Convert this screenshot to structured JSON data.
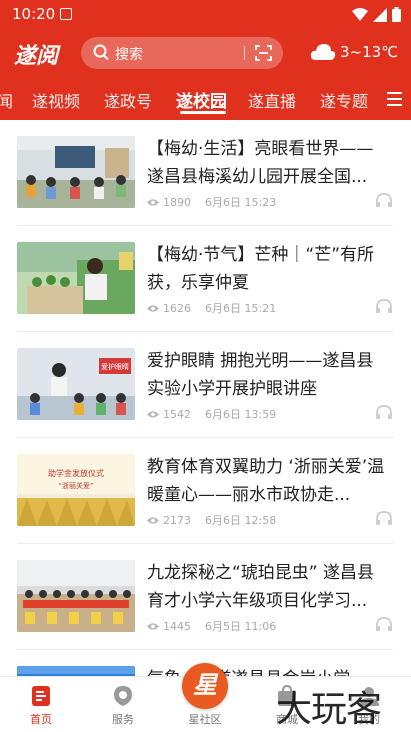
{
  "status": {
    "time": "10:20"
  },
  "header": {
    "logo": "遂阅",
    "search_placeholder": "搜索",
    "weather": "3~13℃"
  },
  "tabs": [
    {
      "label": "闻"
    },
    {
      "label": "遂视频"
    },
    {
      "label": "遂政号"
    },
    {
      "label": "遂校园",
      "active": true
    },
    {
      "label": "遂直播"
    },
    {
      "label": "遂专题"
    }
  ],
  "feed": [
    {
      "title": "【梅幼·生活】亮眼看世界——遂昌县梅溪幼儿园开展全国...",
      "views": "1890",
      "time": "6月6日 15:23"
    },
    {
      "title": "【梅幼·节气】芒种｜“芒”有所获，乐享仲夏",
      "views": "1626",
      "time": "6月6日 15:21"
    },
    {
      "title": "爱护眼睛 拥抱光明——遂昌县实验小学开展护眼讲座",
      "views": "1542",
      "time": "6月6日 13:59"
    },
    {
      "title": "教育体育双翼助力 ‘浙丽关爱’温暖童心——丽水市政协走...",
      "views": "2173",
      "time": "6月6日 12:58"
    },
    {
      "title": "九龙探秘之“琥珀昆虫” 遂昌县育才小学六年级项目化学习...",
      "views": "1445",
      "time": "6月5日 11:06"
    },
    {
      "title": "气象...全道遂昌县金岸小学",
      "views": "",
      "time": ""
    }
  ],
  "thumb_texts": {
    "t3_banner": "爱护眼睛",
    "t4_line1": "助学金发放仪式",
    "t4_line2": "“浙丽关爱”"
  },
  "bottom_nav": [
    {
      "label": "首页",
      "active": true
    },
    {
      "label": "服务"
    },
    {
      "label": "星社区"
    },
    {
      "label": "商城"
    },
    {
      "label": "我的"
    }
  ],
  "star_glyph": "星",
  "watermark": "大玩客",
  "colors": {
    "brand_red": "#e0301e",
    "star_orange": "#e85a20"
  }
}
